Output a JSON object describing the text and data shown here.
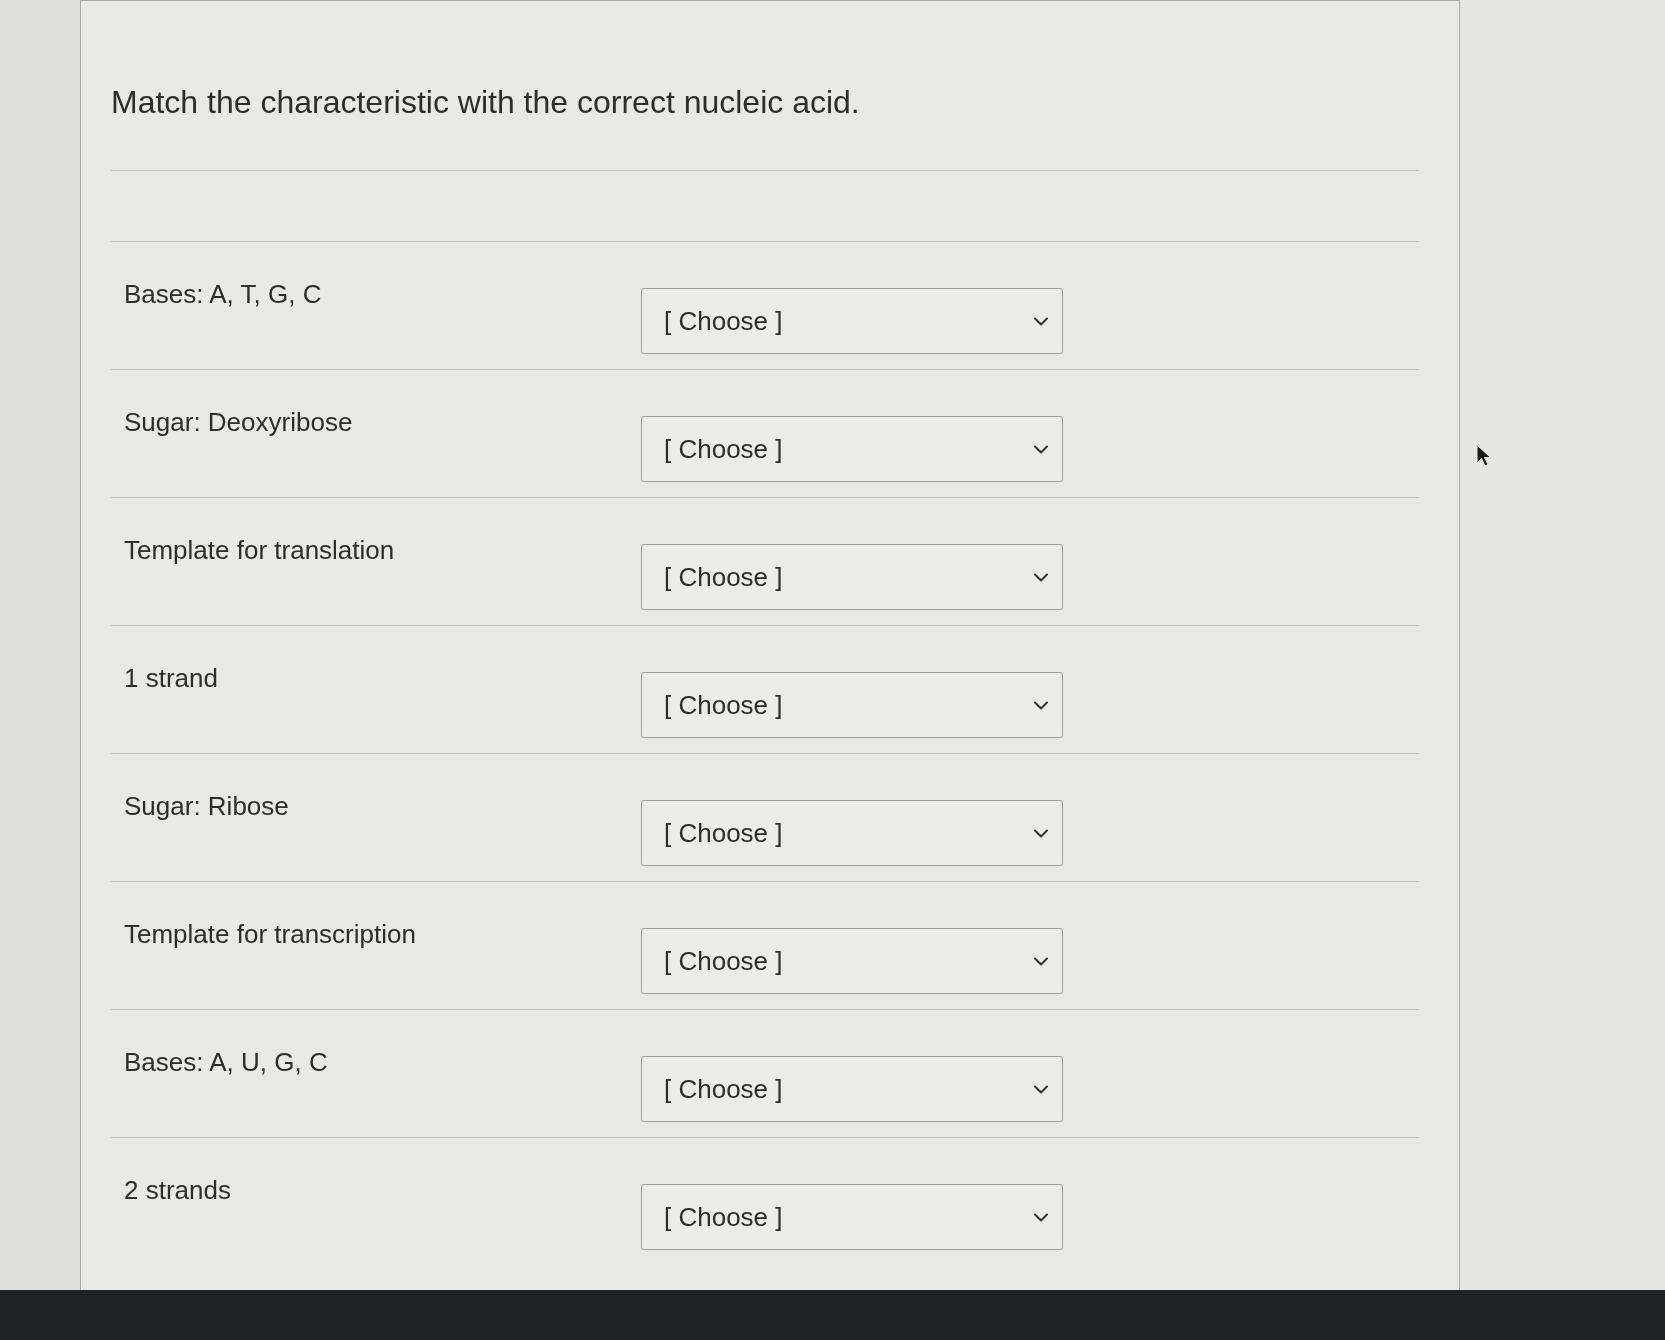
{
  "question": {
    "text": "Match the characteristic with the correct nucleic acid."
  },
  "items": [
    {
      "label": "Bases: A, T, G, C",
      "dropdown": {
        "value": "[ Choose ]"
      }
    },
    {
      "label": "Sugar: Deoxyribose",
      "dropdown": {
        "value": "[ Choose ]"
      }
    },
    {
      "label": "Template for translation",
      "dropdown": {
        "value": "[ Choose ]"
      }
    },
    {
      "label": "1 strand",
      "dropdown": {
        "value": "[ Choose ]"
      }
    },
    {
      "label": "Sugar: Ribose",
      "dropdown": {
        "value": "[ Choose ]"
      }
    },
    {
      "label": "Template for transcription",
      "dropdown": {
        "value": "[ Choose ]"
      }
    },
    {
      "label": "Bases: A, U, G, C",
      "dropdown": {
        "value": "[ Choose ]"
      }
    },
    {
      "label": "2 strands",
      "dropdown": {
        "value": "[ Choose ]"
      }
    }
  ]
}
